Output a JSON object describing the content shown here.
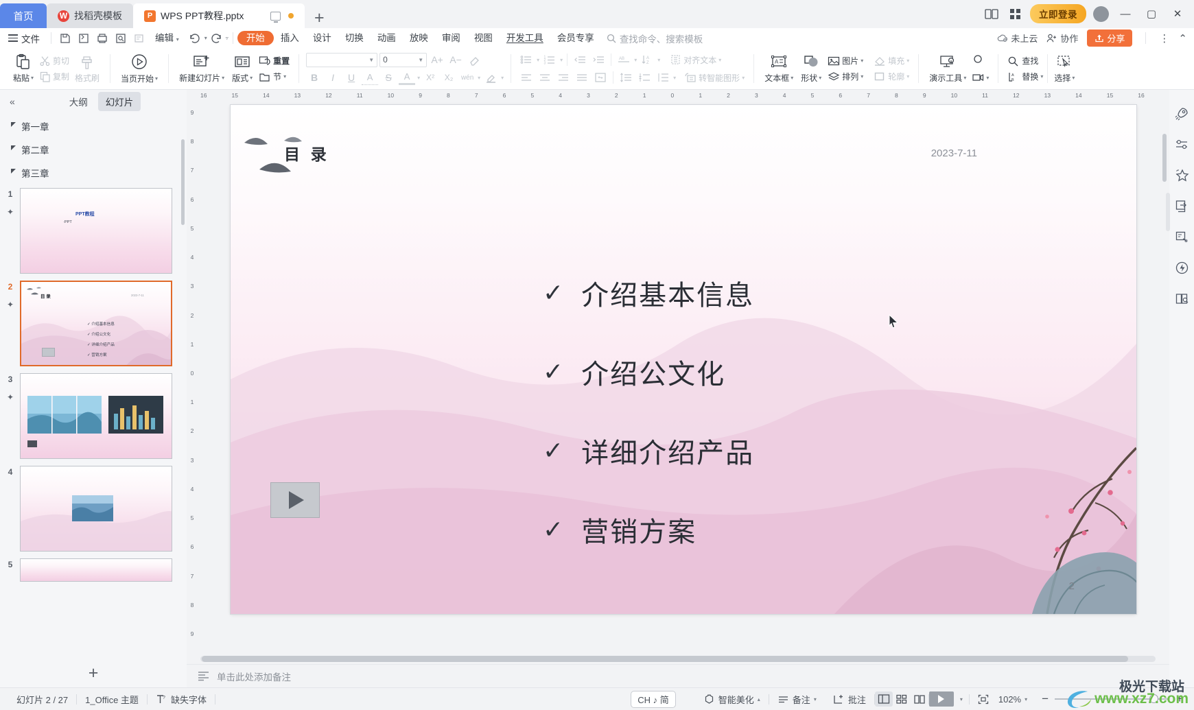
{
  "window": {
    "tabs": [
      {
        "label": "首页",
        "icon": "home-tab",
        "type": "home"
      },
      {
        "label": "找稻壳模板",
        "icon": "docer-icon",
        "type": "template"
      },
      {
        "label": "WPS PPT教程.pptx",
        "icon": "wps-ppt-icon",
        "type": "document",
        "active": true
      }
    ],
    "new_tab_label": "+",
    "vip_button": "立即登录",
    "minimize": "—",
    "maximize": "▢",
    "close": "✕"
  },
  "menubar": {
    "file_label": "文件",
    "quick_icons": [
      "save-icon",
      "save-as-icon",
      "print-icon",
      "print-preview-icon",
      "edit-doc-icon"
    ],
    "edit_label": "编辑",
    "undo_icon": "undo-icon",
    "redo_icon": "redo-icon",
    "items": [
      "开始",
      "插入",
      "设计",
      "切换",
      "动画",
      "放映",
      "审阅",
      "视图",
      "开发工具",
      "会员专享"
    ],
    "active_item": "开始",
    "search_placeholder": "查找命令、搜索模板",
    "cloud_status": "未上云",
    "collaborate": "协作",
    "share": "分享",
    "more": "⋮",
    "collapse_ribbon": "⌃"
  },
  "ribbon": {
    "paste": "粘贴",
    "cut": "剪切",
    "copy": "复制",
    "format_painter": "格式刷",
    "start_from_current": "当页开始",
    "new_slide": "新建幻灯片",
    "layout": "版式",
    "reset": "重置",
    "section": "节",
    "font_name": "",
    "font_size": "0",
    "grow_font": "A+",
    "shrink_font": "A−",
    "clear_format": "clear-format-icon",
    "bold": "B",
    "italic": "I",
    "underline": "U",
    "char_border": "A",
    "strikethrough": "S",
    "font_color": "A",
    "superscript": "X²",
    "subscript": "X₂",
    "phonetic": "wén",
    "highlight": "highlight-icon",
    "align_text": "对齐文本",
    "to_smartart": "转智能图形",
    "text_box": "文本框",
    "shape": "形状",
    "picture": "图片",
    "arrange": "排列",
    "fill": "填充",
    "outline": "轮廓",
    "present_tools": "演示工具",
    "find": "查找",
    "replace": "替换",
    "select": "选择"
  },
  "left_panel": {
    "collapse_icon": "collapse-panel-icon",
    "tabs": [
      {
        "label": "大纲",
        "active": false
      },
      {
        "label": "幻灯片",
        "active": true
      }
    ],
    "chapters": [
      "第一章",
      "第二章",
      "第三章"
    ],
    "thumbnails": [
      {
        "number": "1",
        "selected": false,
        "lines": [
          "PPT教程",
          "·PPT"
        ]
      },
      {
        "number": "2",
        "selected": true,
        "lines": [
          "介绍基本信息",
          "介绍公文化",
          "详细介绍产品",
          "营销方案"
        ],
        "date": "2023-7-11"
      },
      {
        "number": "3",
        "selected": false,
        "lines": []
      },
      {
        "number": "4",
        "selected": false,
        "lines": []
      },
      {
        "number": "5",
        "selected": false,
        "lines": []
      }
    ],
    "add_slide": "+"
  },
  "rulers": {
    "horizontal": [
      "16",
      "15",
      "14",
      "13",
      "12",
      "11",
      "10",
      "9",
      "8",
      "7",
      "6",
      "5",
      "4",
      "3",
      "2",
      "1",
      "0",
      "1",
      "2",
      "3",
      "4",
      "5",
      "6",
      "7",
      "8",
      "9",
      "10",
      "11",
      "12",
      "13",
      "14",
      "15",
      "16"
    ],
    "vertical": [
      "9",
      "8",
      "7",
      "6",
      "5",
      "4",
      "3",
      "2",
      "1",
      "0",
      "1",
      "2",
      "3",
      "4",
      "5",
      "6",
      "7",
      "8",
      "9"
    ]
  },
  "slide": {
    "title": "目 录",
    "date": "2023-7-11",
    "bullets": [
      {
        "check": "✓",
        "text": "介绍基本信息"
      },
      {
        "check": "✓",
        "text": "介绍公文化"
      },
      {
        "check": "✓",
        "text": "详细介绍产品"
      },
      {
        "check": "✓",
        "text": "营销方案"
      }
    ],
    "page_number": "2",
    "video_placeholder": "play-icon"
  },
  "notes": {
    "icon": "notes-icon",
    "placeholder": "单击此处添加备注"
  },
  "right_rail": {
    "icons": [
      "rocket-icon",
      "settings-sliders-icon",
      "magic-star-icon",
      "export-icon",
      "design-ideas-icon",
      "lightning-icon",
      "reading-icon"
    ]
  },
  "statusbar": {
    "slide_counter": "幻灯片 2 / 27",
    "theme": "1_Office 主题",
    "missing_font": "缺失字体",
    "ime": "CH ♪ 简",
    "smart_beautify": "智能美化",
    "notes_btn": "备注",
    "comment_btn": "批注",
    "view_normal": "normal-view-icon",
    "view_sorter": "slide-sorter-icon",
    "view_reading": "reading-view-icon",
    "play": "play-icon",
    "fit_window": "fit-to-window-icon",
    "zoom_level": "102%",
    "zoom_out": "−",
    "zoom_in": "+"
  },
  "watermark": {
    "brand": "极光下载站",
    "url": "www.xz7.com"
  },
  "colors": {
    "accent_orange": "#f2703a",
    "tab_home_blue": "#5b87e8",
    "selected_thumb": "#e06a2a",
    "chrome_bg": "#f2f3f5",
    "slide_pink": "#f3cde3"
  }
}
